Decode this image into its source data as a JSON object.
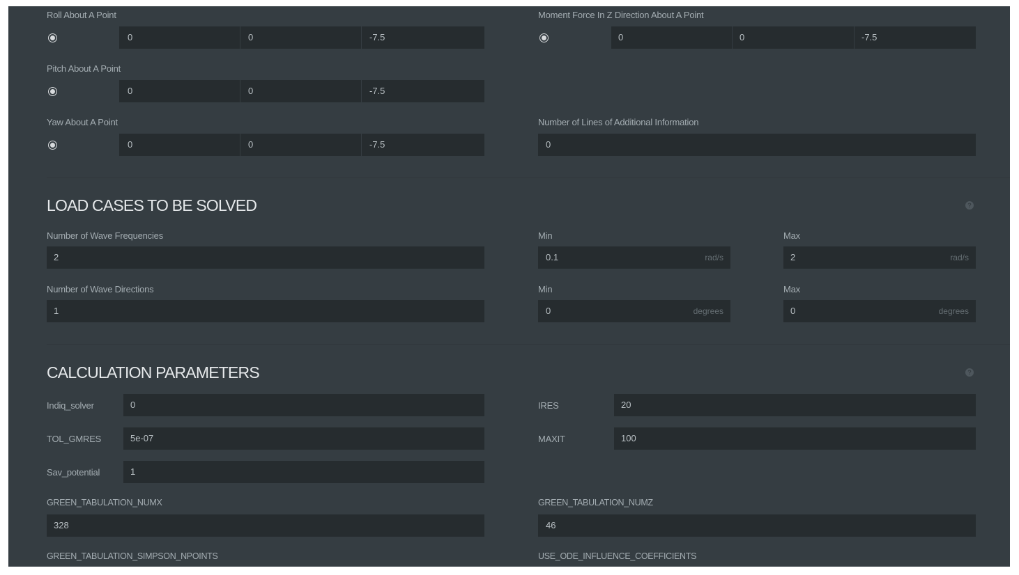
{
  "point_fields": {
    "roll": {
      "label": "Roll About A Point",
      "values": [
        "0",
        "0",
        "-7.5"
      ]
    },
    "pitch": {
      "label": "Pitch About A Point",
      "values": [
        "0",
        "0",
        "-7.5"
      ]
    },
    "yaw": {
      "label": "Yaw About A Point",
      "values": [
        "0",
        "0",
        "-7.5"
      ]
    },
    "moment_z": {
      "label": "Moment Force In Z Direction About A Point",
      "values": [
        "0",
        "0",
        "-7.5"
      ]
    }
  },
  "additional_info": {
    "label": "Number of Lines of Additional Information",
    "value": "0"
  },
  "load_cases": {
    "title": "LOAD CASES TO BE SOLVED",
    "help": "?",
    "frequencies": {
      "label": "Number of Wave Frequencies",
      "value": "2",
      "min_label": "Min",
      "min_value": "0.1",
      "min_unit": "rad/s",
      "max_label": "Max",
      "max_value": "2",
      "max_unit": "rad/s"
    },
    "directions": {
      "label": "Number of Wave Directions",
      "value": "1",
      "min_label": "Min",
      "min_value": "0",
      "min_unit": "degrees",
      "max_label": "Max",
      "max_value": "0",
      "max_unit": "degrees"
    }
  },
  "calc_params": {
    "title": "CALCULATION PARAMETERS",
    "help": "?",
    "indiq_solver": {
      "label": "Indiq_solver",
      "value": "0"
    },
    "ires": {
      "label": "IRES",
      "value": "20"
    },
    "tol_gmres": {
      "label": "TOL_GMRES",
      "value": "5e-07"
    },
    "maxit": {
      "label": "MAXIT",
      "value": "100"
    },
    "sav_potential": {
      "label": "Sav_potential",
      "value": "1"
    },
    "green_numx": {
      "label": "GREEN_TABULATION_NUMX",
      "value": "328"
    },
    "green_numz": {
      "label": "GREEN_TABULATION_NUMZ",
      "value": "46"
    },
    "green_simpson": {
      "label": "GREEN_TABULATION_SIMPSON_NPOINTS"
    },
    "use_ode": {
      "label": "USE_ODE_INFLUENCE_COEFFICIENTS"
    }
  }
}
